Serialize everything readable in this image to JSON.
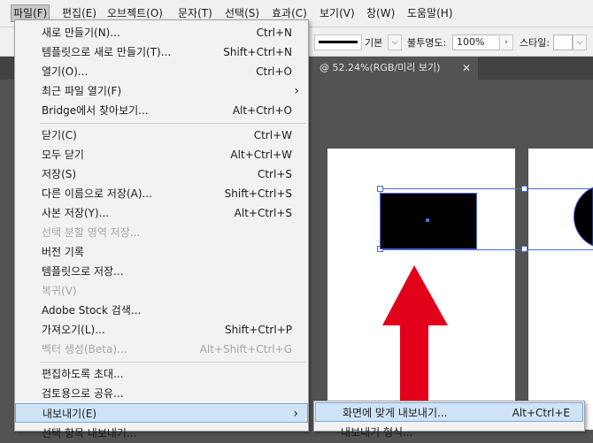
{
  "menubar": {
    "items": [
      "파일(F)",
      "편집(E)",
      "오브젝트(O)",
      "문자(T)",
      "선택(S)",
      "효과(C)",
      "보기(V)",
      "창(W)",
      "도움말(H)"
    ]
  },
  "controlbar": {
    "stroke_style": "기본",
    "opacity_label": "불투명도:",
    "opacity_value": "100%",
    "style_label": "스타일:"
  },
  "document_tab": {
    "title": "@ 52.24%(RGB/미리 보기)",
    "close": "✕"
  },
  "file_menu": {
    "items": [
      {
        "label": "새로 만들기(N)...",
        "shortcut": "Ctrl+N"
      },
      {
        "label": "템플릿으로 새로 만들기(T)...",
        "shortcut": "Shift+Ctrl+N"
      },
      {
        "label": "열기(O)...",
        "shortcut": "Ctrl+O"
      },
      {
        "label": "최근 파일 열기(F)",
        "shortcut": "›"
      },
      {
        "label": "Bridge에서 찾아보기...",
        "shortcut": "Alt+Ctrl+O"
      },
      {
        "label": "닫기(C)",
        "shortcut": "Ctrl+W"
      },
      {
        "label": "모두 닫기",
        "shortcut": "Alt+Ctrl+W"
      },
      {
        "label": "저장(S)",
        "shortcut": "Ctrl+S"
      },
      {
        "label": "다른 이름으로 저장(A)...",
        "shortcut": "Shift+Ctrl+S"
      },
      {
        "label": "사본 저장(Y)...",
        "shortcut": "Alt+Ctrl+S"
      },
      {
        "label": "선택 분할 영역 저장...",
        "shortcut": ""
      },
      {
        "label": "버전 기록",
        "shortcut": ""
      },
      {
        "label": "템플릿으로 저장...",
        "shortcut": ""
      },
      {
        "label": "복귀(V)",
        "shortcut": ""
      },
      {
        "label": "Adobe Stock 검색...",
        "shortcut": ""
      },
      {
        "label": "가져오기(L)...",
        "shortcut": "Shift+Ctrl+P"
      },
      {
        "label": "벡터 생성(Beta)...",
        "shortcut": "Alt+Shift+Ctrl+G"
      },
      {
        "label": "편집하도록 초대...",
        "shortcut": ""
      },
      {
        "label": "검토용으로 공유...",
        "shortcut": ""
      },
      {
        "label": "내보내기(E)",
        "shortcut": "›"
      },
      {
        "label": "선택 항목 내보내기...",
        "shortcut": ""
      }
    ]
  },
  "export_submenu": {
    "items": [
      {
        "label": "화면에 맞게 내보내기...",
        "shortcut": "Alt+Ctrl+E"
      },
      {
        "label": "내보내기 형식...",
        "shortcut": ""
      }
    ]
  },
  "colors": {
    "arrow": "#e3001b",
    "selection": "#4c6bd6",
    "menu_highlight": "#cfe3f6"
  }
}
